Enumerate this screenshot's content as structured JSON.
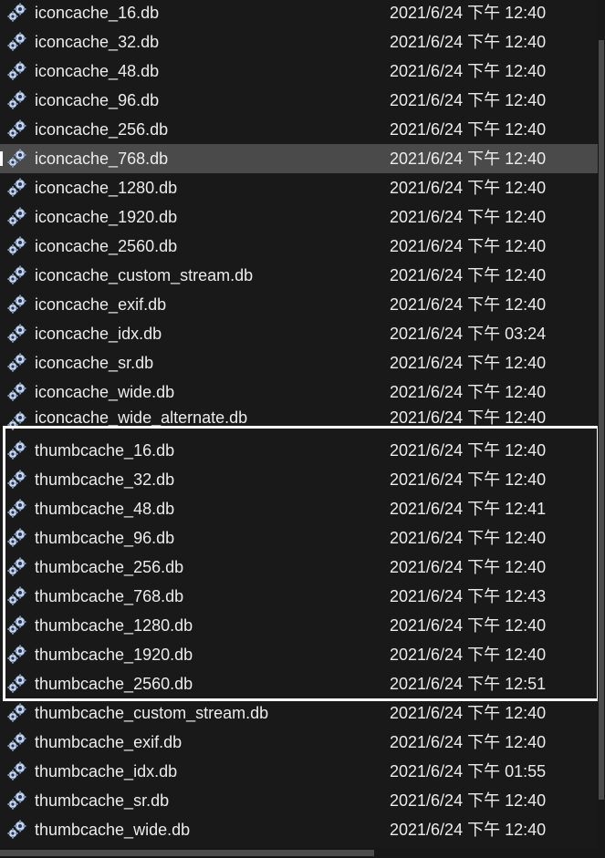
{
  "files": [
    {
      "name": "iconcache_16.db",
      "date": "2021/6/24 下午 12:40",
      "icon": "system-file-gear-icon"
    },
    {
      "name": "iconcache_32.db",
      "date": "2021/6/24 下午 12:40",
      "icon": "system-file-gear-icon"
    },
    {
      "name": "iconcache_48.db",
      "date": "2021/6/24 下午 12:40",
      "icon": "system-file-gear-icon"
    },
    {
      "name": "iconcache_96.db",
      "date": "2021/6/24 下午 12:40",
      "icon": "system-file-gear-icon"
    },
    {
      "name": "iconcache_256.db",
      "date": "2021/6/24 下午 12:40",
      "icon": "system-file-gear-icon"
    },
    {
      "name": "iconcache_768.db",
      "date": "2021/6/24 下午 12:40",
      "icon": "system-file-gear-icon",
      "selected": true
    },
    {
      "name": "iconcache_1280.db",
      "date": "2021/6/24 下午 12:40",
      "icon": "system-file-gear-icon"
    },
    {
      "name": "iconcache_1920.db",
      "date": "2021/6/24 下午 12:40",
      "icon": "system-file-gear-icon"
    },
    {
      "name": "iconcache_2560.db",
      "date": "2021/6/24 下午 12:40",
      "icon": "system-file-gear-icon"
    },
    {
      "name": "iconcache_custom_stream.db",
      "date": "2021/6/24 下午 12:40",
      "icon": "system-file-gear-icon"
    },
    {
      "name": "iconcache_exif.db",
      "date": "2021/6/24 下午 12:40",
      "icon": "system-file-gear-icon"
    },
    {
      "name": "iconcache_idx.db",
      "date": "2021/6/24 下午 03:24",
      "icon": "system-file-gear-icon"
    },
    {
      "name": "iconcache_sr.db",
      "date": "2021/6/24 下午 12:40",
      "icon": "system-file-gear-icon"
    },
    {
      "name": "iconcache_wide.db",
      "date": "2021/6/24 下午 12:40",
      "icon": "system-file-gear-icon"
    },
    {
      "name": "iconcache_wide_alternate.db",
      "date": "2021/6/24 下午 12:40",
      "icon": "system-file-gear-icon",
      "partial": true
    },
    {
      "name": "thumbcache_16.db",
      "date": "2021/6/24 下午 12:40",
      "icon": "system-file-gear-icon"
    },
    {
      "name": "thumbcache_32.db",
      "date": "2021/6/24 下午 12:40",
      "icon": "system-file-gear-icon"
    },
    {
      "name": "thumbcache_48.db",
      "date": "2021/6/24 下午 12:41",
      "icon": "system-file-gear-icon"
    },
    {
      "name": "thumbcache_96.db",
      "date": "2021/6/24 下午 12:40",
      "icon": "system-file-gear-icon"
    },
    {
      "name": "thumbcache_256.db",
      "date": "2021/6/24 下午 12:40",
      "icon": "system-file-gear-icon"
    },
    {
      "name": "thumbcache_768.db",
      "date": "2021/6/24 下午 12:43",
      "icon": "system-file-gear-icon"
    },
    {
      "name": "thumbcache_1280.db",
      "date": "2021/6/24 下午 12:40",
      "icon": "system-file-gear-icon"
    },
    {
      "name": "thumbcache_1920.db",
      "date": "2021/6/24 下午 12:40",
      "icon": "system-file-gear-icon"
    },
    {
      "name": "thumbcache_2560.db",
      "date": "2021/6/24 下午 12:51",
      "icon": "system-file-gear-icon"
    },
    {
      "name": "thumbcache_custom_stream.db",
      "date": "2021/6/24 下午 12:40",
      "icon": "system-file-gear-icon"
    },
    {
      "name": "thumbcache_exif.db",
      "date": "2021/6/24 下午 12:40",
      "icon": "system-file-gear-icon"
    },
    {
      "name": "thumbcache_idx.db",
      "date": "2021/6/24 下午 01:55",
      "icon": "system-file-gear-icon"
    },
    {
      "name": "thumbcache_sr.db",
      "date": "2021/6/24 下午 12:40",
      "icon": "system-file-gear-icon"
    },
    {
      "name": "thumbcache_wide.db",
      "date": "2021/6/24 下午 12:40",
      "icon": "system-file-gear-icon"
    }
  ],
  "colors": {
    "background": "#191919",
    "selected_row": "#4a4a4a",
    "text": "#ececec",
    "highlight_border": "#ffffff",
    "icon_body": "#c8d6ec",
    "icon_gear": "#7d93b8"
  }
}
